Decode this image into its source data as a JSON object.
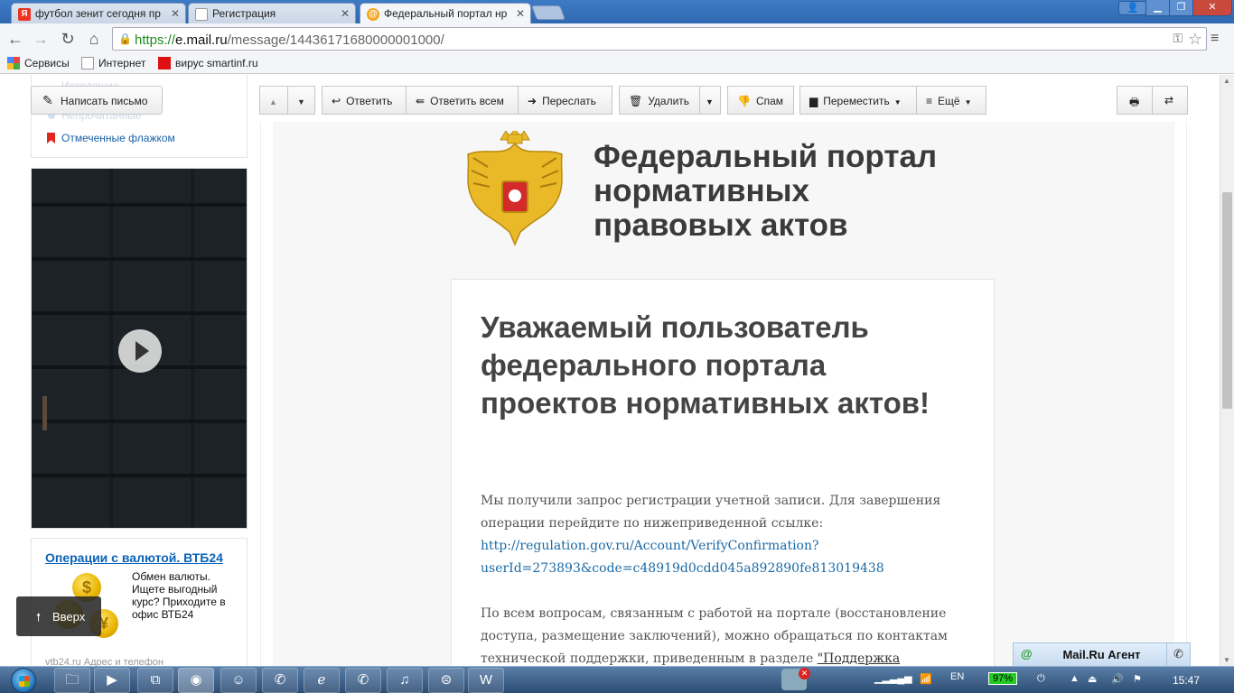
{
  "browser": {
    "tabs": [
      {
        "label": "футбол зенит сегодня пр",
        "favicon": "Я"
      },
      {
        "label": "Регистрация",
        "favicon": ""
      },
      {
        "label": "Федеральный портал нр",
        "favicon": "@"
      }
    ],
    "url_scheme": "https://",
    "url_host": "e.mail.ru",
    "url_path": "/message/14436171680000001000/",
    "bookmarks": [
      "Сервисы",
      "Интернет",
      "вирус smartinf.ru"
    ]
  },
  "sidebar": {
    "folder_flagged": "Отмеченные флажком",
    "faded_item_1": "Исходящие...",
    "faded_item_2": "Непрочитанные",
    "compose_label": "Написать письмо"
  },
  "ad": {
    "title": "Операции с валютой. ВТБ24",
    "text": "Обмен валюты. Ищете выгодный курс? Приходите в офис ВТБ24",
    "footer": "vtb24.ru   Адрес и телефон",
    "coin_glyphs": [
      "$",
      "¥"
    ]
  },
  "scroll_top": "Вверх",
  "mail_toolbar": {
    "reply": "Ответить",
    "reply_all": "Ответить всем",
    "forward": "Переслать",
    "delete": "Удалить",
    "spam": "Спам",
    "move": "Переместить",
    "more": "Ещё"
  },
  "message": {
    "portal_title_1": "Федеральный портал",
    "portal_title_2": "нормативных",
    "portal_title_3": "правовых актов",
    "heading": "Уважаемый пользователь федерального портала проектов нормативных актов!",
    "p1": "Мы получили запрос регистрации учетной записи. Для завершения операции перейдите по нижеприведенной ссылке:",
    "link_1": "http://regulation.gov.ru/Account/VerifyConfirmation?",
    "link_2": "userId=273893&code=c48919d0cdd045a892890fe813019438",
    "p2": "По всем вопросам, связанным с работой на портале (восстановление доступа, размещение заключений), можно обращаться по контактам технической поддержки, приведенным в разделе ",
    "p2_link": "\"Поддержка"
  },
  "agent": {
    "label": "Mail.Ru Агент"
  },
  "taskbar": {
    "lang": "EN",
    "battery": "97%",
    "time": "15:47"
  }
}
